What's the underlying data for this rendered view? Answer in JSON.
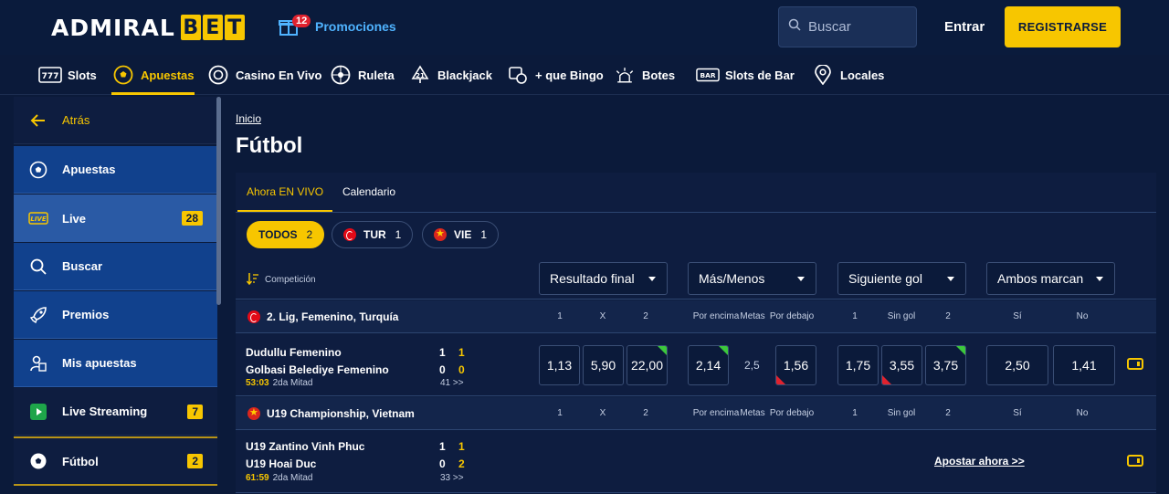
{
  "header": {
    "logo_text": "ADMIRAL",
    "logo_letters": [
      "B",
      "E",
      "T"
    ],
    "promo_count": "12",
    "promo_label": "Promociones",
    "search_placeholder": "Buscar",
    "login_label": "Entrar",
    "register_label": "REGISTRARSE"
  },
  "nav": {
    "items": [
      {
        "label": "Slots",
        "icon": "slot-machine-icon"
      },
      {
        "label": "Apuestas",
        "icon": "soccer-ball-icon"
      },
      {
        "label": "Casino En Vivo",
        "icon": "chip-icon"
      },
      {
        "label": "Ruleta",
        "icon": "roulette-icon"
      },
      {
        "label": "Blackjack",
        "icon": "blackjack-icon"
      },
      {
        "label": "+ que Bingo",
        "icon": "bingo-icon"
      },
      {
        "label": "Botes",
        "icon": "jackpot-icon"
      },
      {
        "label": "Slots de Bar",
        "icon": "bar-icon"
      },
      {
        "label": "Locales",
        "icon": "location-pin-icon"
      }
    ],
    "active_index": 1
  },
  "sidebar": {
    "items": [
      {
        "label": "Atrás",
        "icon": "arrow-left-icon"
      },
      {
        "label": "Apuestas",
        "icon": "soccer-ball-icon"
      },
      {
        "label": "Live",
        "icon": "live-icon",
        "count": "28"
      },
      {
        "label": "Buscar",
        "icon": "search-icon"
      },
      {
        "label": "Premios",
        "icon": "rocket-icon"
      },
      {
        "label": "Mis apuestas",
        "icon": "my-bets-icon"
      },
      {
        "label": "Live Streaming",
        "icon": "play-icon",
        "count": "7"
      },
      {
        "label": "Fútbol",
        "icon": "soccer-ball-icon",
        "count": "2"
      }
    ]
  },
  "main": {
    "breadcrumb": "Inicio",
    "title": "Fútbol",
    "tabs": [
      "Ahora EN VIVO",
      "Calendario"
    ],
    "filters": [
      {
        "label": "TODOS",
        "count": "2"
      },
      {
        "label": "TUR",
        "count": "1"
      },
      {
        "label": "VIE",
        "count": "1"
      }
    ],
    "competition_label": "Competición",
    "markets": [
      "Resultado final",
      "Más/Menos",
      "Siguiente gol",
      "Ambos marcan"
    ],
    "col_headers": {
      "one": "1",
      "x": "X",
      "two": "2",
      "over": "Por encima",
      "metas": "Metas",
      "under": "Por debajo",
      "ng1": "1",
      "nogoal": "Sin gol",
      "ng2": "2",
      "yes": "Sí",
      "no": "No"
    },
    "leagues": [
      {
        "name": "2. Lig, Femenino, Turquía",
        "match": {
          "home": "Dudullu Femenino",
          "away": "Golbasi Belediye Femenino",
          "home_score_a": "1",
          "home_score_b": "1",
          "away_score_a": "0",
          "away_score_b": "0",
          "time": "53:03",
          "period": "2da Mitad",
          "more": "41 >>",
          "odds": {
            "one": "1,13",
            "x": "5,90",
            "two": "22,00",
            "over": "2,14",
            "line": "2,5",
            "under": "1,56",
            "ng1": "1,75",
            "nogoal": "3,55",
            "ng2": "3,75",
            "yes": "2,50",
            "no": "1,41"
          }
        }
      },
      {
        "name": "U19 Championship, Vietnam",
        "match": {
          "home": "U19 Zantino Vinh Phuc",
          "away": "U19 Hoai Duc",
          "home_score_a": "1",
          "home_score_b": "1",
          "away_score_a": "0",
          "away_score_b": "2",
          "time": "61:59",
          "period": "2da Mitad",
          "more": "33 >>",
          "bet_now": "Apostar ahora >>"
        }
      }
    ]
  },
  "colors": {
    "accent": "#f7c600",
    "background": "#0b1a3a",
    "sidebar_blue": "#11418d",
    "odds_up": "#3cc83c",
    "odds_down": "#e0222e",
    "promo_blue": "#4fb3ff"
  }
}
